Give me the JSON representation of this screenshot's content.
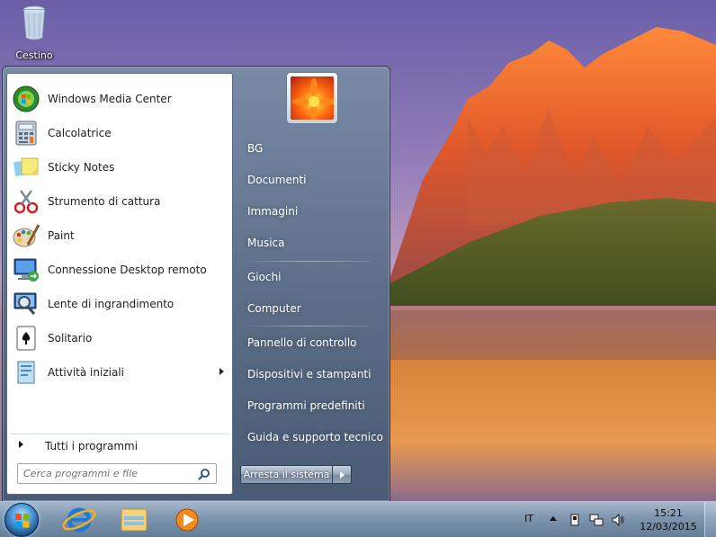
{
  "desktop": {
    "icons": [
      {
        "label": "Cestino",
        "icon": "recycle-bin-icon"
      }
    ]
  },
  "start_menu": {
    "programs": [
      {
        "label": "Windows Media Center",
        "icon": "windows-media-center-icon"
      },
      {
        "label": "Calcolatrice",
        "icon": "calculator-icon"
      },
      {
        "label": "Sticky Notes",
        "icon": "sticky-notes-icon"
      },
      {
        "label": "Strumento di cattura",
        "icon": "snipping-tool-icon"
      },
      {
        "label": "Paint",
        "icon": "paint-icon"
      },
      {
        "label": "Connessione Desktop remoto",
        "icon": "remote-desktop-icon"
      },
      {
        "label": "Lente di ingrandimento",
        "icon": "magnifier-icon"
      },
      {
        "label": "Solitario",
        "icon": "solitaire-icon"
      },
      {
        "label": "Attività iniziali",
        "icon": "getting-started-icon",
        "has_submenu": true
      }
    ],
    "all_programs_label": "Tutti i programmi",
    "search": {
      "placeholder": "Cerca programmi e file"
    },
    "right_items": [
      {
        "label": "BG"
      },
      {
        "label": "Documenti"
      },
      {
        "label": "Immagini"
      },
      {
        "label": "Musica"
      },
      {
        "label": "Giochi"
      },
      {
        "label": "Computer"
      },
      {
        "label": "Pannello di controllo"
      },
      {
        "label": "Dispositivi e stampanti"
      },
      {
        "label": "Programmi predefiniti"
      },
      {
        "label": "Guida e supporto tecnico"
      }
    ],
    "shutdown_label": "Arresta il sistema"
  },
  "taskbar": {
    "pinned": [
      {
        "icon": "internet-explorer-icon"
      },
      {
        "icon": "windows-explorer-icon"
      },
      {
        "icon": "windows-media-player-icon"
      }
    ],
    "tray": {
      "language": "IT",
      "icons": [
        "show-hidden-icons",
        "safely-remove-hardware-icon",
        "network-icon",
        "volume-icon"
      ],
      "time": "15:21",
      "date": "12/03/2015"
    }
  }
}
